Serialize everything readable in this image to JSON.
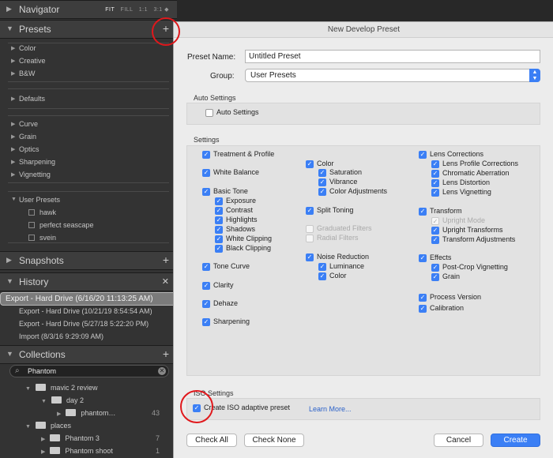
{
  "left_panel": {
    "navigator": {
      "title": "Navigator",
      "zoom": [
        "FIT",
        "FILL",
        "1:1",
        "3:1 ◆"
      ]
    },
    "presets": {
      "title": "Presets",
      "add_label": "+",
      "groups": [
        [
          "Color",
          "Creative",
          "B&W"
        ],
        [
          "Defaults"
        ],
        [
          "Curve",
          "Grain",
          "Optics",
          "Sharpening",
          "Vignetting"
        ]
      ],
      "user_group": "User Presets",
      "user_items": [
        "hawk",
        "perfect seascape",
        "svein"
      ]
    },
    "snapshots": {
      "title": "Snapshots",
      "add_label": "+"
    },
    "history": {
      "title": "History",
      "close_label": "✕",
      "items": [
        "Export - Hard Drive (6/16/20 11:13:25 AM)",
        "Export - Hard Drive (10/21/19 8:54:54 AM)",
        "Export - Hard Drive (5/27/18 5:22:20 PM)",
        "Import (8/3/16 9:29:09 AM)"
      ]
    },
    "collections": {
      "title": "Collections",
      "add_label": "+",
      "search_value": "Phantom",
      "items": [
        {
          "label": "mavic 2 review",
          "count": ""
        },
        {
          "label": "day 2",
          "count": ""
        },
        {
          "label": "phantom…",
          "count": "43"
        },
        {
          "label": "places",
          "count": ""
        },
        {
          "label": "Phantom 3",
          "count": "7"
        },
        {
          "label": "Phantom shoot",
          "count": "1"
        }
      ]
    }
  },
  "dialog": {
    "title": "New Develop Preset",
    "preset_name_label": "Preset Name:",
    "preset_name_value": "Untitled Preset",
    "group_label": "Group:",
    "group_value": "User Presets",
    "auto_settings_header": "Auto Settings",
    "auto_settings_checkbox": "Auto Settings",
    "settings_header": "Settings",
    "col1": {
      "treatment_profile": "Treatment & Profile",
      "white_balance": "White Balance",
      "basic_tone": "Basic Tone",
      "basic_tone_items": [
        "Exposure",
        "Contrast",
        "Highlights",
        "Shadows",
        "White Clipping",
        "Black Clipping"
      ],
      "tone_curve": "Tone Curve",
      "clarity": "Clarity",
      "dehaze": "Dehaze",
      "sharpening": "Sharpening"
    },
    "col2": {
      "color": "Color",
      "color_items": [
        "Saturation",
        "Vibrance",
        "Color Adjustments"
      ],
      "split_toning": "Split Toning",
      "graduated_filters": "Graduated Filters",
      "radial_filters": "Radial Filters",
      "noise_reduction": "Noise Reduction",
      "noise_items": [
        "Luminance",
        "Color"
      ]
    },
    "col3": {
      "lens_corrections": "Lens Corrections",
      "lens_items": [
        "Lens Profile Corrections",
        "Chromatic Aberration",
        "Lens Distortion",
        "Lens Vignetting"
      ],
      "transform": "Transform",
      "transform_items": [
        "Upright Mode",
        "Upright Transforms",
        "Transform Adjustments"
      ],
      "effects": "Effects",
      "effects_items": [
        "Post-Crop Vignetting",
        "Grain"
      ],
      "process_version": "Process Version",
      "calibration": "Calibration"
    },
    "iso_header": "ISO Settings",
    "iso_checkbox": "Create ISO adaptive preset",
    "learn_more": "Learn More...",
    "buttons": {
      "check_all": "Check All",
      "check_none": "Check None",
      "cancel": "Cancel",
      "create": "Create"
    }
  },
  "colors": {
    "accent": "#3b7ff5",
    "annotation_circle": "#e0181c"
  }
}
